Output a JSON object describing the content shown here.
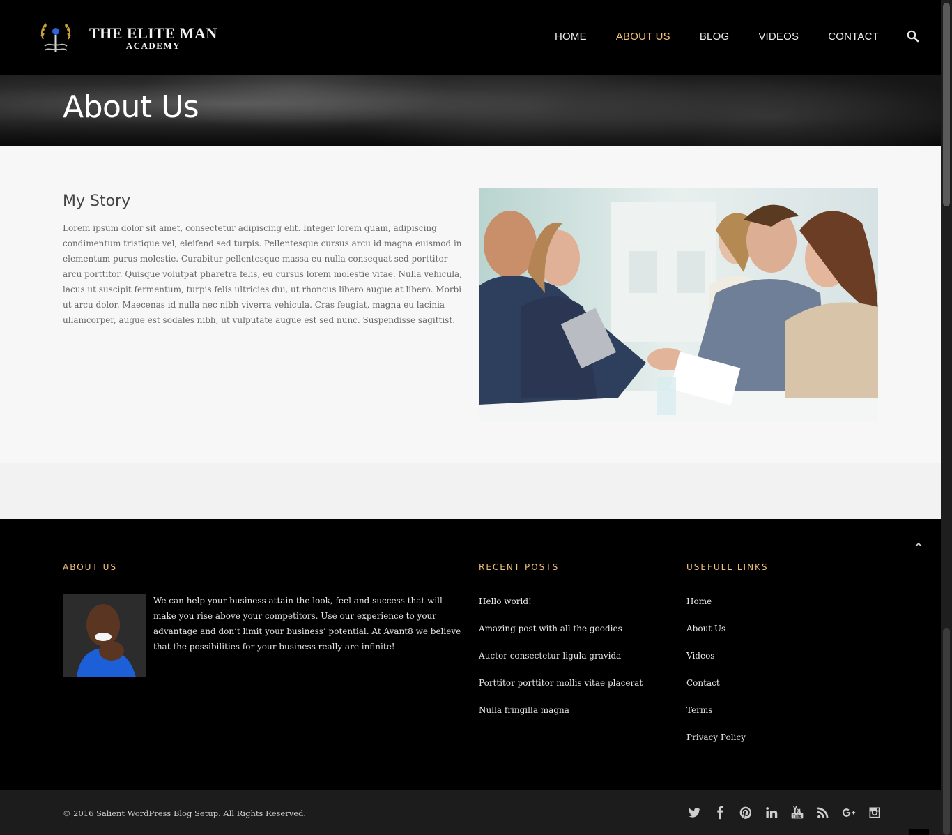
{
  "brand": {
    "line1": "THE ELITE MAN",
    "line2": "ACADEMY"
  },
  "nav": {
    "items": [
      {
        "label": "HOME"
      },
      {
        "label": "ABOUT US",
        "active": true
      },
      {
        "label": "BLOG"
      },
      {
        "label": "VIDEOS"
      },
      {
        "label": "CONTACT"
      }
    ],
    "search_icon": "search-icon"
  },
  "page_title": "About Us",
  "story": {
    "heading": "My Story",
    "body": "Lorem ipsum dolor sit amet, consectetur adipiscing elit. Integer lorem quam, adipiscing condimentum tristique vel, eleifend sed turpis. Pellentesque cursus arcu id magna euismod in elementum purus molestie. Curabitur pellentesque massa eu nulla consequat sed porttitor arcu porttitor. Quisque volutpat pharetra felis, eu cursus lorem molestie vitae. Nulla vehicula, lacus ut suscipit fermentum, turpis felis ultricies dui, ut rhoncus libero augue at libero. Morbi ut arcu dolor. Maecenas id nulla nec nibh viverra vehicula. Cras feugiat, magna eu lacinia ullamcorper, augue est sodales nibh, ut vulputate augue est sed nunc. Suspendisse sagittist."
  },
  "footer": {
    "about": {
      "heading": "ABOUT US",
      "text": "We can help your business attain the look, feel and success that will make you rise above your competitors. Use our experience to your advantage and don’t limit your business’ potential. At Avant8 we believe that the possibilities for your business really are infinite!"
    },
    "recent_posts": {
      "heading": "RECENT POSTS",
      "items": [
        "Hello world!",
        "Amazing post with all the goodies",
        "Auctor consectetur ligula gravida",
        "Porttitor porttitor mollis vitae placerat",
        "Nulla fringilla magna"
      ]
    },
    "useful_links": {
      "heading": "USEFULL LINKS",
      "items": [
        "Home",
        "About Us",
        "Videos",
        "Contact",
        "Terms",
        "Privacy Policy"
      ]
    },
    "copyright": "© 2016 Salient WordPress Blog Setup. All Rights Reserved.",
    "socials": [
      "twitter-icon",
      "facebook-icon",
      "pinterest-icon",
      "linkedin-icon",
      "youtube-icon",
      "rss-icon",
      "google-plus-icon",
      "instagram-icon"
    ]
  },
  "colors": {
    "accent": "#f2c27a",
    "header_bg": "#000000",
    "content_bg": "#f7f7f7"
  }
}
